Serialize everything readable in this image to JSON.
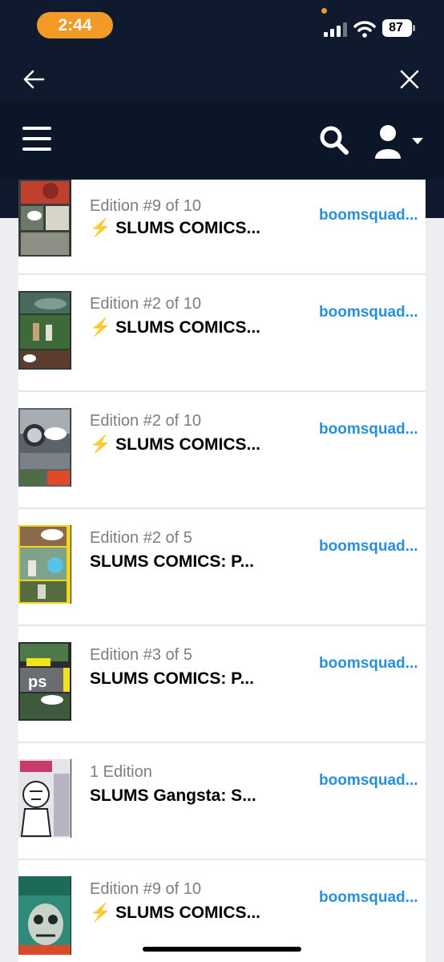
{
  "status": {
    "time": "2:44",
    "battery": "87"
  },
  "colors": {
    "header_bg": "#0f1a2e",
    "accent_orange": "#f29a26",
    "link_blue": "#2a8fd9"
  },
  "icons": {
    "back": "back-arrow-icon",
    "close": "close-icon",
    "menu": "hamburger-menu-icon",
    "search": "search-icon",
    "user": "user-icon",
    "bolt": "lightning-bolt-icon"
  },
  "items": [
    {
      "edition": "Edition #9 of 10",
      "bolt": true,
      "title": "SLUMS COMICS...",
      "owner": "boomsquad..."
    },
    {
      "edition": "Edition #2 of 10",
      "bolt": true,
      "title": "SLUMS COMICS...",
      "owner": "boomsquad..."
    },
    {
      "edition": "Edition #2 of 10",
      "bolt": true,
      "title": "SLUMS COMICS...",
      "owner": "boomsquad..."
    },
    {
      "edition": "Edition #2 of 5",
      "bolt": false,
      "title": "SLUMS COMICS: P...",
      "owner": "boomsquad..."
    },
    {
      "edition": "Edition #3 of 5",
      "bolt": false,
      "title": "SLUMS COMICS: P...",
      "owner": "boomsquad..."
    },
    {
      "edition": "1 Edition",
      "bolt": false,
      "title": "SLUMS Gangsta: S...",
      "owner": "boomsquad..."
    },
    {
      "edition": "Edition #9 of 10",
      "bolt": true,
      "title": "SLUMS COMICS...",
      "owner": "boomsquad..."
    }
  ],
  "bolt_glyph": "⚡"
}
